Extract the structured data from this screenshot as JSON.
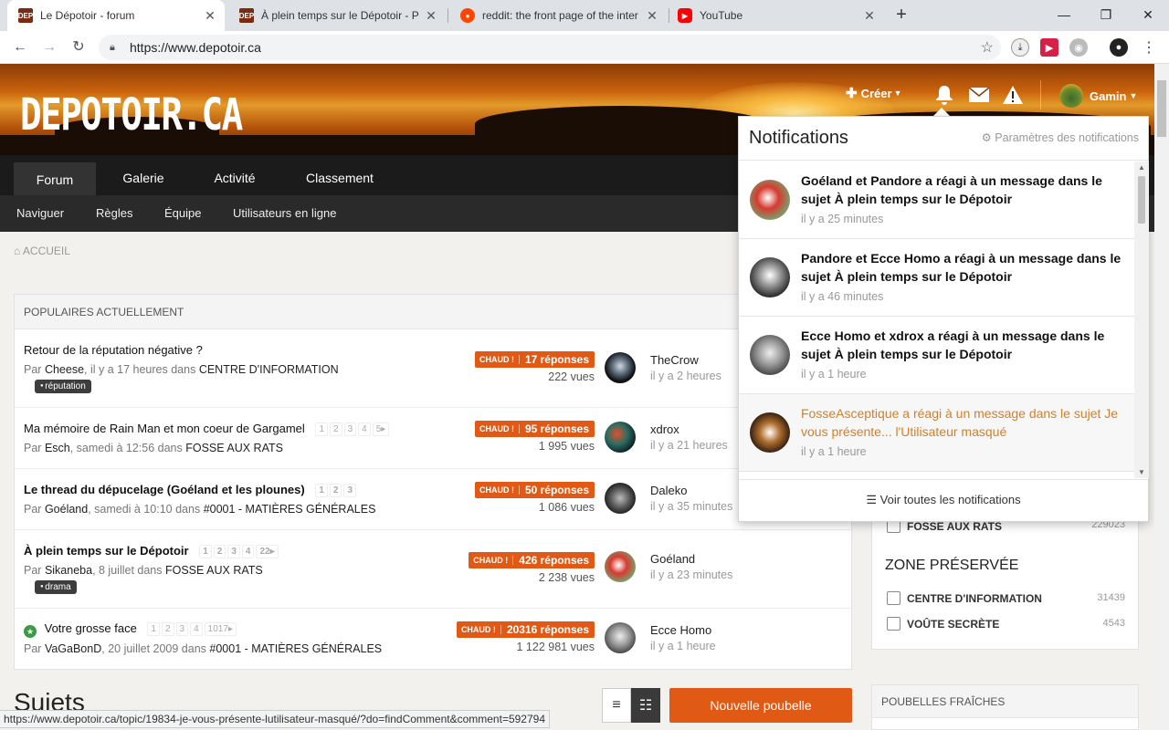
{
  "browser": {
    "tabs": [
      {
        "title": "Le Dépotoir - forum",
        "favicon": "DEP"
      },
      {
        "title": "À plein temps sur le Dépotoir - P",
        "favicon": "DEP"
      },
      {
        "title": "reddit: the front page of the inter",
        "favicon": "reddit-icon"
      },
      {
        "title": "YouTube",
        "favicon": "youtube-icon"
      }
    ],
    "url": "https://www.depotoir.ca",
    "status_url": "https://www.depotoir.ca/topic/19834-je-vous-présente-lutilisateur-masqué/?do=findComment&comment=592794"
  },
  "header": {
    "logo": "DEPOTOIR.CA",
    "create_label": "Créer",
    "user_label": "Gamin"
  },
  "nav": {
    "main": [
      "Forum",
      "Galerie",
      "Activité",
      "Classement"
    ],
    "sub": [
      "Naviguer",
      "Règles",
      "Équipe",
      "Utilisateurs en ligne"
    ]
  },
  "breadcrumb": "ACCUEIL",
  "popular": {
    "heading": "POPULAIRES ACTUELLEMENT",
    "hot_label": "CHAUD !",
    "topics": [
      {
        "title": "Retour de la réputation négative ?",
        "bold": false,
        "pages": [],
        "by": "Par",
        "author": "Cheese",
        "when": ", il y a 17 heures dans ",
        "forum": "CENTRE D'INFORMATION",
        "tag": "réputation",
        "replies": "17 réponses",
        "views": "222 vues",
        "last_user": "TheCrow",
        "last_time": "il y a 2 heures"
      },
      {
        "title": "Ma mémoire de Rain Man et mon coeur de Gargamel",
        "bold": false,
        "pages": [
          "1",
          "2",
          "3",
          "4",
          "5▸"
        ],
        "by": "Par",
        "author": "Esch",
        "when": ", samedi à 12:56 dans ",
        "forum": "FOSSE AUX RATS",
        "tag": "",
        "replies": "95 réponses",
        "views": "1 995 vues",
        "last_user": "xdrox",
        "last_time": "il y a 21 heures"
      },
      {
        "title": "Le thread du dépucelage (Goéland et les plounes)",
        "bold": true,
        "pages": [
          "1",
          "2",
          "3"
        ],
        "by": "Par",
        "author": "Goéland",
        "when": ", samedi à 10:10 dans ",
        "forum": "#0001 - MATIÈRES GÉNÉRALES",
        "tag": "",
        "replies": "50 réponses",
        "views": "1 086 vues",
        "last_user": "Daleko",
        "last_time": "il y a 35 minutes"
      },
      {
        "title": "À plein temps sur le Dépotoir",
        "bold": true,
        "pages": [
          "1",
          "2",
          "3",
          "4",
          "22▸"
        ],
        "by": "Par",
        "author": "Sikaneba",
        "when": ", 8 juillet dans ",
        "forum": "FOSSE AUX RATS",
        "tag": "drama",
        "replies": "426 réponses",
        "views": "2 238 vues",
        "last_user": "Goéland",
        "last_time": "il y a 23 minutes"
      },
      {
        "title": "Votre grosse face",
        "bold": false,
        "pinned": true,
        "pages": [
          "1",
          "2",
          "3",
          "4",
          "1017▸"
        ],
        "by": "Par",
        "author": "VaGaBonD",
        "when": ", 20 juillet 2009 dans ",
        "forum": "#0001 - MATIÈRES GÉNÉRALES",
        "tag": "",
        "replies": "20316 réponses",
        "views": "1 122 981 vues",
        "last_user": "Ecce Homo",
        "last_time": "il y a 1 heure"
      }
    ]
  },
  "topics_heading": "Sujets",
  "new_button": "Nouvelle poubelle",
  "sidebar": {
    "partial_cat": {
      "label": "FOSSE AUX RATS",
      "count": "229023"
    },
    "zone_title": "ZONE PRÉSERVÉE",
    "zone_cats": [
      {
        "label": "CENTRE D'INFORMATION",
        "count": "31439"
      },
      {
        "label": "VOÛTE SECRÈTE",
        "count": "4543"
      }
    ],
    "fresh_heading": "POUBELLES FRAÎCHES"
  },
  "notifications": {
    "title": "Notifications",
    "settings_label": "Paramètres des notifications",
    "items": [
      {
        "text": "Goéland et Pandore a réagi à un message dans le sujet À plein temps sur le Dépotoir",
        "time": "il y a 25 minutes",
        "read": false
      },
      {
        "text": "Pandore et Ecce Homo a réagi à un message dans le sujet À plein temps sur le Dépotoir",
        "time": "il y a 46 minutes",
        "read": false
      },
      {
        "text": "Ecce Homo et xdrox a réagi à un message dans le sujet À plein temps sur le Dépotoir",
        "time": "il y a 1 heure",
        "read": false
      },
      {
        "text": "FosseAsceptique a réagi à un message dans le sujet Je vous présente... l'Utilisateur masqué",
        "time": "il y a 1 heure",
        "read": true
      }
    ],
    "footer_label": "Voir toutes les notifications"
  },
  "colors": {
    "accent": "#e05a16",
    "nav_bg": "#1b1b1b",
    "read_notif": "#d0802a"
  }
}
